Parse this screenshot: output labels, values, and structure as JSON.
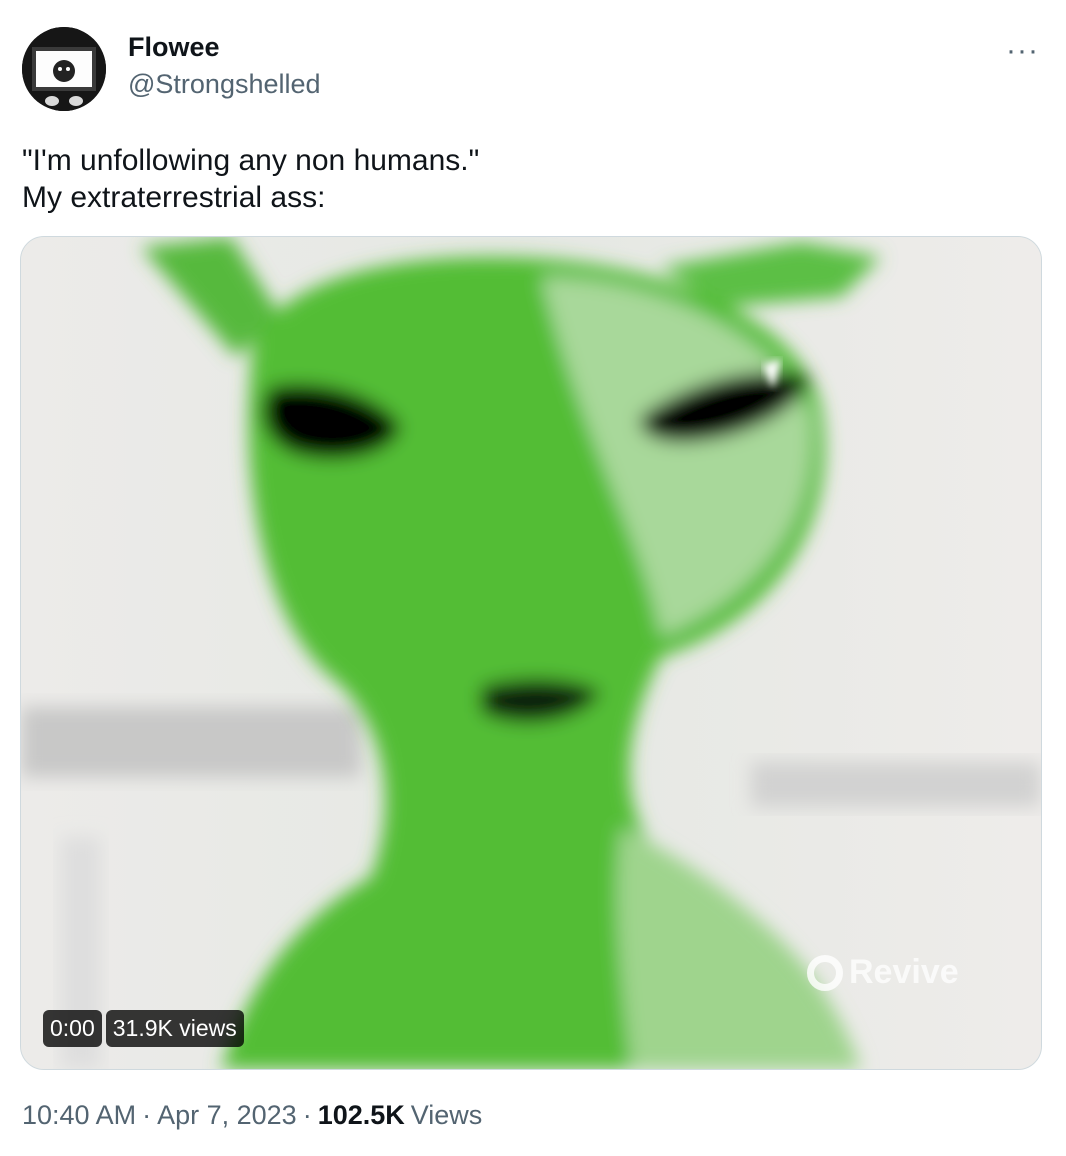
{
  "author": {
    "name": "Flowee",
    "handle": "@Strongshelled",
    "avatar_icon": "profile-avatar-icon"
  },
  "more_label": "···",
  "tweet": {
    "lines": [
      "\"I'm unfollowing any non humans.\"",
      "My extraterrestrial ass:"
    ]
  },
  "media": {
    "time": "0:00",
    "views": "31.9K views",
    "watermark": "Revive"
  },
  "meta": {
    "time": "10:40 AM",
    "sep1": "·",
    "date": "Apr 7, 2023",
    "sep2": "·",
    "views_count": "102.5K",
    "views_label": "Views"
  },
  "colors": {
    "text": "#0f1419",
    "secondary": "#536471",
    "alien_green": "#4dbd3a"
  }
}
